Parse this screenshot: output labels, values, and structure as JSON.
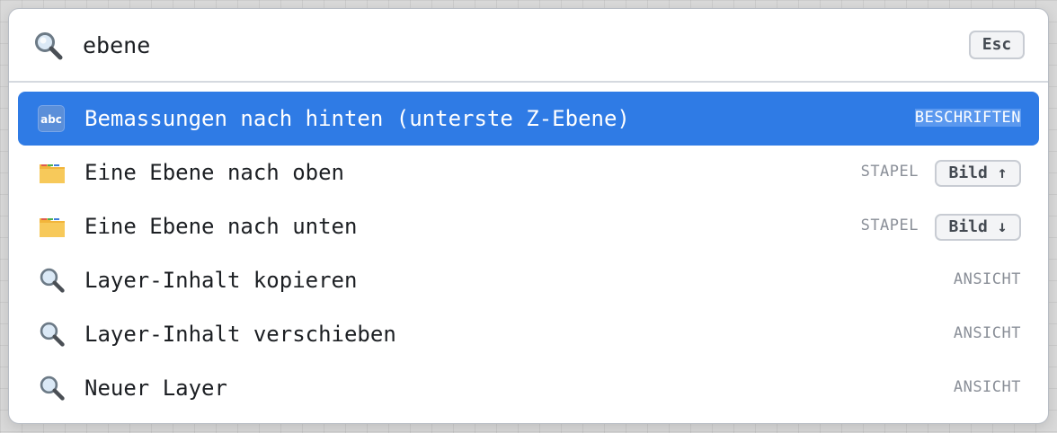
{
  "search": {
    "value": "ebene",
    "esc_label": "Esc",
    "icon": "magnifier-icon"
  },
  "results": [
    {
      "label": "Bemassungen nach hinten (unterste Z-Ebene)",
      "category": "BESCHRIFTEN",
      "shortcut": "",
      "icon": "abc-icon",
      "selected": true
    },
    {
      "label": "Eine Ebene nach oben",
      "category": "STAPEL",
      "shortcut": "Bild ↑",
      "icon": "folder-icon",
      "selected": false
    },
    {
      "label": "Eine Ebene nach unten",
      "category": "STAPEL",
      "shortcut": "Bild ↓",
      "icon": "folder-icon",
      "selected": false
    },
    {
      "label": "Layer-Inhalt kopieren",
      "category": "ANSICHT",
      "shortcut": "",
      "icon": "magnifier-icon",
      "selected": false
    },
    {
      "label": "Layer-Inhalt verschieben",
      "category": "ANSICHT",
      "shortcut": "",
      "icon": "magnifier-icon",
      "selected": false
    },
    {
      "label": "Neuer Layer",
      "category": "ANSICHT",
      "shortcut": "",
      "icon": "magnifier-icon",
      "selected": false
    }
  ],
  "colors": {
    "selection": "#2f7be5",
    "category_text": "#8a8f98"
  }
}
